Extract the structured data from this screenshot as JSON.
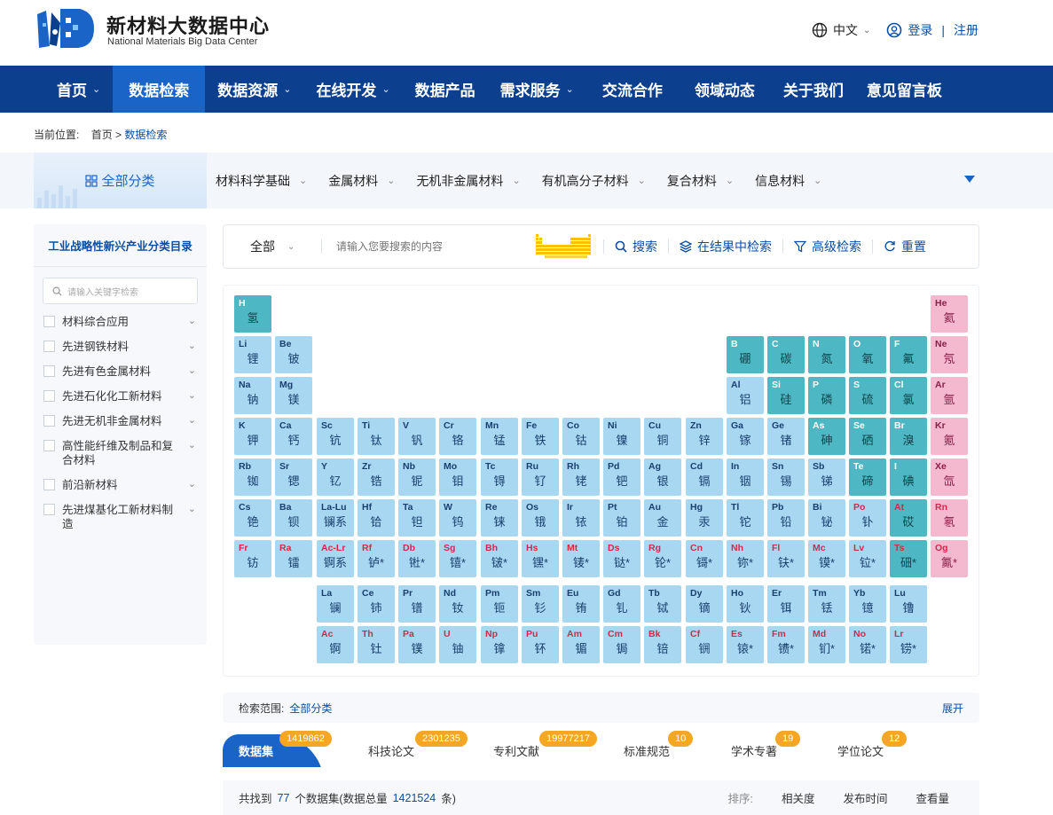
{
  "header": {
    "logo_title": "新材料大数据中心",
    "logo_subtitle": "National Materials Big Data Center",
    "lang": "中文",
    "login": "登录",
    "separator": "|",
    "register": "注册"
  },
  "nav": [
    {
      "label": "首页",
      "has_dropdown": true
    },
    {
      "label": "数据检索",
      "has_dropdown": false,
      "active": true
    },
    {
      "label": "数据资源",
      "has_dropdown": true
    },
    {
      "label": "在线开发",
      "has_dropdown": true
    },
    {
      "label": "数据产品",
      "has_dropdown": false
    },
    {
      "label": "需求服务",
      "has_dropdown": true
    },
    {
      "label": "交流合作",
      "has_dropdown": false
    },
    {
      "label": "领域动态",
      "has_dropdown": false
    },
    {
      "label": "关于我们",
      "has_dropdown": false
    },
    {
      "label": "意见留言板",
      "has_dropdown": false
    }
  ],
  "breadcrumb": {
    "prefix": "当前位置:",
    "home": "首页",
    "sep": ">",
    "current": "数据检索"
  },
  "categories": {
    "all": "全部分类",
    "items": [
      "材料科学基础",
      "金属材料",
      "无机非金属材料",
      "有机高分子材料",
      "复合材料",
      "信息材料"
    ]
  },
  "sidebar": {
    "title": "工业战略性新兴产业分类目录",
    "search_placeholder": "请输入关键字检索",
    "items": [
      "材料综合应用",
      "先进钢铁材料",
      "先进有色金属材料",
      "先进石化化工新材料",
      "先进无机非金属材料",
      "高性能纤维及制品和复合材料",
      "前沿新材料",
      "先进煤基化工新材料制造"
    ]
  },
  "search": {
    "scope": "全部",
    "placeholder": "请输入您要搜索的内容",
    "search_btn": "搜索",
    "in_result_btn": "在结果中检索",
    "advanced_btn": "高级检索",
    "reset_btn": "重置"
  },
  "periodic_table": [
    {
      "sym": "H",
      "cn": "氢",
      "row": 0,
      "col": 0,
      "type": "tl"
    },
    {
      "sym": "He",
      "cn": "氦",
      "row": 0,
      "col": 17,
      "type": "pk"
    },
    {
      "sym": "Li",
      "cn": "锂",
      "row": 1,
      "col": 0,
      "type": "lb"
    },
    {
      "sym": "Be",
      "cn": "铍",
      "row": 1,
      "col": 1,
      "type": "lb"
    },
    {
      "sym": "B",
      "cn": "硼",
      "row": 1,
      "col": 12,
      "type": "tl"
    },
    {
      "sym": "C",
      "cn": "碳",
      "row": 1,
      "col": 13,
      "type": "tl"
    },
    {
      "sym": "N",
      "cn": "氮",
      "row": 1,
      "col": 14,
      "type": "tl"
    },
    {
      "sym": "O",
      "cn": "氧",
      "row": 1,
      "col": 15,
      "type": "tl"
    },
    {
      "sym": "F",
      "cn": "氟",
      "row": 1,
      "col": 16,
      "type": "tl"
    },
    {
      "sym": "Ne",
      "cn": "氖",
      "row": 1,
      "col": 17,
      "type": "pk"
    },
    {
      "sym": "Na",
      "cn": "钠",
      "row": 2,
      "col": 0,
      "type": "lb"
    },
    {
      "sym": "Mg",
      "cn": "镁",
      "row": 2,
      "col": 1,
      "type": "lb"
    },
    {
      "sym": "Al",
      "cn": "铝",
      "row": 2,
      "col": 12,
      "type": "lb"
    },
    {
      "sym": "Si",
      "cn": "硅",
      "row": 2,
      "col": 13,
      "type": "tl"
    },
    {
      "sym": "P",
      "cn": "磷",
      "row": 2,
      "col": 14,
      "type": "tl"
    },
    {
      "sym": "S",
      "cn": "硫",
      "row": 2,
      "col": 15,
      "type": "tl"
    },
    {
      "sym": "Cl",
      "cn": "氯",
      "row": 2,
      "col": 16,
      "type": "tl"
    },
    {
      "sym": "Ar",
      "cn": "氩",
      "row": 2,
      "col": 17,
      "type": "pk"
    },
    {
      "sym": "K",
      "cn": "钾",
      "row": 3,
      "col": 0,
      "type": "lb"
    },
    {
      "sym": "Ca",
      "cn": "钙",
      "row": 3,
      "col": 1,
      "type": "lb"
    },
    {
      "sym": "Sc",
      "cn": "钪",
      "row": 3,
      "col": 2,
      "type": "lb"
    },
    {
      "sym": "Ti",
      "cn": "钛",
      "row": 3,
      "col": 3,
      "type": "lb"
    },
    {
      "sym": "V",
      "cn": "钒",
      "row": 3,
      "col": 4,
      "type": "lb"
    },
    {
      "sym": "Cr",
      "cn": "铬",
      "row": 3,
      "col": 5,
      "type": "lb"
    },
    {
      "sym": "Mn",
      "cn": "锰",
      "row": 3,
      "col": 6,
      "type": "lb"
    },
    {
      "sym": "Fe",
      "cn": "铁",
      "row": 3,
      "col": 7,
      "type": "lb"
    },
    {
      "sym": "Co",
      "cn": "钴",
      "row": 3,
      "col": 8,
      "type": "lb"
    },
    {
      "sym": "Ni",
      "cn": "镍",
      "row": 3,
      "col": 9,
      "type": "lb"
    },
    {
      "sym": "Cu",
      "cn": "铜",
      "row": 3,
      "col": 10,
      "type": "lb"
    },
    {
      "sym": "Zn",
      "cn": "锌",
      "row": 3,
      "col": 11,
      "type": "lb"
    },
    {
      "sym": "Ga",
      "cn": "镓",
      "row": 3,
      "col": 12,
      "type": "lb"
    },
    {
      "sym": "Ge",
      "cn": "锗",
      "row": 3,
      "col": 13,
      "type": "lb"
    },
    {
      "sym": "As",
      "cn": "砷",
      "row": 3,
      "col": 14,
      "type": "tl"
    },
    {
      "sym": "Se",
      "cn": "硒",
      "row": 3,
      "col": 15,
      "type": "tl"
    },
    {
      "sym": "Br",
      "cn": "溴",
      "row": 3,
      "col": 16,
      "type": "tl"
    },
    {
      "sym": "Kr",
      "cn": "氪",
      "row": 3,
      "col": 17,
      "type": "pk"
    },
    {
      "sym": "Rb",
      "cn": "铷",
      "row": 4,
      "col": 0,
      "type": "lb"
    },
    {
      "sym": "Sr",
      "cn": "锶",
      "row": 4,
      "col": 1,
      "type": "lb"
    },
    {
      "sym": "Y",
      "cn": "钇",
      "row": 4,
      "col": 2,
      "type": "lb"
    },
    {
      "sym": "Zr",
      "cn": "锆",
      "row": 4,
      "col": 3,
      "type": "lb"
    },
    {
      "sym": "Nb",
      "cn": "铌",
      "row": 4,
      "col": 4,
      "type": "lb"
    },
    {
      "sym": "Mo",
      "cn": "钼",
      "row": 4,
      "col": 5,
      "type": "lb"
    },
    {
      "sym": "Tc",
      "cn": "锝",
      "row": 4,
      "col": 6,
      "type": "lb"
    },
    {
      "sym": "Ru",
      "cn": "钌",
      "row": 4,
      "col": 7,
      "type": "lb"
    },
    {
      "sym": "Rh",
      "cn": "铑",
      "row": 4,
      "col": 8,
      "type": "lb"
    },
    {
      "sym": "Pd",
      "cn": "钯",
      "row": 4,
      "col": 9,
      "type": "lb"
    },
    {
      "sym": "Ag",
      "cn": "银",
      "row": 4,
      "col": 10,
      "type": "lb"
    },
    {
      "sym": "Cd",
      "cn": "镉",
      "row": 4,
      "col": 11,
      "type": "lb"
    },
    {
      "sym": "In",
      "cn": "铟",
      "row": 4,
      "col": 12,
      "type": "lb"
    },
    {
      "sym": "Sn",
      "cn": "锡",
      "row": 4,
      "col": 13,
      "type": "lb"
    },
    {
      "sym": "Sb",
      "cn": "锑",
      "row": 4,
      "col": 14,
      "type": "lb"
    },
    {
      "sym": "Te",
      "cn": "碲",
      "row": 4,
      "col": 15,
      "type": "tl"
    },
    {
      "sym": "I",
      "cn": "碘",
      "row": 4,
      "col": 16,
      "type": "tl"
    },
    {
      "sym": "Xe",
      "cn": "氙",
      "row": 4,
      "col": 17,
      "type": "pk"
    },
    {
      "sym": "Cs",
      "cn": "铯",
      "row": 5,
      "col": 0,
      "type": "lb"
    },
    {
      "sym": "Ba",
      "cn": "钡",
      "row": 5,
      "col": 1,
      "type": "lb"
    },
    {
      "sym": "La-Lu",
      "cn": "镧系",
      "row": 5,
      "col": 2,
      "type": "lb"
    },
    {
      "sym": "Hf",
      "cn": "铪",
      "row": 5,
      "col": 3,
      "type": "lb"
    },
    {
      "sym": "Ta",
      "cn": "钽",
      "row": 5,
      "col": 4,
      "type": "lb"
    },
    {
      "sym": "W",
      "cn": "钨",
      "row": 5,
      "col": 5,
      "type": "lb"
    },
    {
      "sym": "Re",
      "cn": "铼",
      "row": 5,
      "col": 6,
      "type": "lb"
    },
    {
      "sym": "Os",
      "cn": "锇",
      "row": 5,
      "col": 7,
      "type": "lb"
    },
    {
      "sym": "Ir",
      "cn": "铱",
      "row": 5,
      "col": 8,
      "type": "lb"
    },
    {
      "sym": "Pt",
      "cn": "铂",
      "row": 5,
      "col": 9,
      "type": "lb"
    },
    {
      "sym": "Au",
      "cn": "金",
      "row": 5,
      "col": 10,
      "type": "lb"
    },
    {
      "sym": "Hg",
      "cn": "汞",
      "row": 5,
      "col": 11,
      "type": "lb"
    },
    {
      "sym": "Tl",
      "cn": "铊",
      "row": 5,
      "col": 12,
      "type": "lb"
    },
    {
      "sym": "Pb",
      "cn": "铅",
      "row": 5,
      "col": 13,
      "type": "lb"
    },
    {
      "sym": "Bi",
      "cn": "铋",
      "row": 5,
      "col": 14,
      "type": "lb"
    },
    {
      "sym": "Po",
      "cn": "钋",
      "row": 5,
      "col": 15,
      "type": "lb",
      "red": true
    },
    {
      "sym": "At",
      "cn": "砹",
      "row": 5,
      "col": 16,
      "type": "tl",
      "red": true
    },
    {
      "sym": "Rn",
      "cn": "氡",
      "row": 5,
      "col": 17,
      "type": "pk",
      "red": true
    },
    {
      "sym": "Fr",
      "cn": "钫",
      "row": 6,
      "col": 0,
      "type": "lb",
      "red": true
    },
    {
      "sym": "Ra",
      "cn": "镭",
      "row": 6,
      "col": 1,
      "type": "lb",
      "red": true
    },
    {
      "sym": "Ac-Lr",
      "cn": "锕系",
      "row": 6,
      "col": 2,
      "type": "lb",
      "red": true
    },
    {
      "sym": "Rf",
      "cn": "𬬻*",
      "row": 6,
      "col": 3,
      "type": "lb",
      "red": true
    },
    {
      "sym": "Db",
      "cn": "𬭊*",
      "row": 6,
      "col": 4,
      "type": "lb",
      "red": true
    },
    {
      "sym": "Sg",
      "cn": "𬭳*",
      "row": 6,
      "col": 5,
      "type": "lb",
      "red": true
    },
    {
      "sym": "Bh",
      "cn": "𬭛*",
      "row": 6,
      "col": 6,
      "type": "lb",
      "red": true
    },
    {
      "sym": "Hs",
      "cn": "𬭶*",
      "row": 6,
      "col": 7,
      "type": "lb",
      "red": true
    },
    {
      "sym": "Mt",
      "cn": "鿏*",
      "row": 6,
      "col": 8,
      "type": "lb",
      "red": true
    },
    {
      "sym": "Ds",
      "cn": "𫟼*",
      "row": 6,
      "col": 9,
      "type": "lb",
      "red": true
    },
    {
      "sym": "Rg",
      "cn": "𬬭*",
      "row": 6,
      "col": 10,
      "type": "lb",
      "red": true
    },
    {
      "sym": "Cn",
      "cn": "鿔*",
      "row": 6,
      "col": 11,
      "type": "lb",
      "red": true
    },
    {
      "sym": "Nh",
      "cn": "鿭*",
      "row": 6,
      "col": 12,
      "type": "lb",
      "red": true
    },
    {
      "sym": "Fl",
      "cn": "𫓧*",
      "row": 6,
      "col": 13,
      "type": "lb",
      "red": true
    },
    {
      "sym": "Mc",
      "cn": "镆*",
      "row": 6,
      "col": 14,
      "type": "lb",
      "red": true
    },
    {
      "sym": "Lv",
      "cn": "𫟷*",
      "row": 6,
      "col": 15,
      "type": "lb",
      "red": true
    },
    {
      "sym": "Ts",
      "cn": "鿬*",
      "row": 6,
      "col": 16,
      "type": "tl",
      "red": true
    },
    {
      "sym": "Og",
      "cn": "鿫*",
      "row": 6,
      "col": 17,
      "type": "pk",
      "red": true
    },
    {
      "sym": "La",
      "cn": "镧",
      "row": 7,
      "col": 2,
      "type": "lb"
    },
    {
      "sym": "Ce",
      "cn": "铈",
      "row": 7,
      "col": 3,
      "type": "lb"
    },
    {
      "sym": "Pr",
      "cn": "镨",
      "row": 7,
      "col": 4,
      "type": "lb"
    },
    {
      "sym": "Nd",
      "cn": "钕",
      "row": 7,
      "col": 5,
      "type": "lb"
    },
    {
      "sym": "Pm",
      "cn": "钷",
      "row": 7,
      "col": 6,
      "type": "lb"
    },
    {
      "sym": "Sm",
      "cn": "钐",
      "row": 7,
      "col": 7,
      "type": "lb"
    },
    {
      "sym": "Eu",
      "cn": "铕",
      "row": 7,
      "col": 8,
      "type": "lb"
    },
    {
      "sym": "Gd",
      "cn": "钆",
      "row": 7,
      "col": 9,
      "type": "lb"
    },
    {
      "sym": "Tb",
      "cn": "铽",
      "row": 7,
      "col": 10,
      "type": "lb"
    },
    {
      "sym": "Dy",
      "cn": "镝",
      "row": 7,
      "col": 11,
      "type": "lb"
    },
    {
      "sym": "Ho",
      "cn": "钬",
      "row": 7,
      "col": 12,
      "type": "lb"
    },
    {
      "sym": "Er",
      "cn": "铒",
      "row": 7,
      "col": 13,
      "type": "lb"
    },
    {
      "sym": "Tm",
      "cn": "铥",
      "row": 7,
      "col": 14,
      "type": "lb"
    },
    {
      "sym": "Yb",
      "cn": "镱",
      "row": 7,
      "col": 15,
      "type": "lb"
    },
    {
      "sym": "Lu",
      "cn": "镥",
      "row": 7,
      "col": 16,
      "type": "lb"
    },
    {
      "sym": "Ac",
      "cn": "锕",
      "row": 8,
      "col": 2,
      "type": "lb",
      "red": true
    },
    {
      "sym": "Th",
      "cn": "钍",
      "row": 8,
      "col": 3,
      "type": "lb",
      "red": true
    },
    {
      "sym": "Pa",
      "cn": "镤",
      "row": 8,
      "col": 4,
      "type": "lb",
      "red": true
    },
    {
      "sym": "U",
      "cn": "铀",
      "row": 8,
      "col": 5,
      "type": "lb",
      "red": true
    },
    {
      "sym": "Np",
      "cn": "镎",
      "row": 8,
      "col": 6,
      "type": "lb",
      "red": true
    },
    {
      "sym": "Pu",
      "cn": "钚",
      "row": 8,
      "col": 7,
      "type": "lb",
      "red": true
    },
    {
      "sym": "Am",
      "cn": "镅",
      "row": 8,
      "col": 8,
      "type": "lb",
      "red": true
    },
    {
      "sym": "Cm",
      "cn": "锔",
      "row": 8,
      "col": 9,
      "type": "lb",
      "red": true
    },
    {
      "sym": "Bk",
      "cn": "锫",
      "row": 8,
      "col": 10,
      "type": "lb",
      "red": true
    },
    {
      "sym": "Cf",
      "cn": "锎",
      "row": 8,
      "col": 11,
      "type": "lb",
      "red": true
    },
    {
      "sym": "Es",
      "cn": "锿*",
      "row": 8,
      "col": 12,
      "type": "lb",
      "red": true
    },
    {
      "sym": "Fm",
      "cn": "镄*",
      "row": 8,
      "col": 13,
      "type": "lb",
      "red": true
    },
    {
      "sym": "Md",
      "cn": "钔*",
      "row": 8,
      "col": 14,
      "type": "lb",
      "red": true
    },
    {
      "sym": "No",
      "cn": "锘*",
      "row": 8,
      "col": 15,
      "type": "lb",
      "red": true
    },
    {
      "sym": "Lr",
      "cn": "铹*",
      "row": 8,
      "col": 16,
      "type": "lb",
      "red": true
    }
  ],
  "range": {
    "label": "检索范围:",
    "value": "全部分类",
    "expand": "展开"
  },
  "tabs": [
    {
      "label": "数据集",
      "count": "1419862"
    },
    {
      "label": "科技论文",
      "count": "2301235"
    },
    {
      "label": "专利文献",
      "count": "19977217"
    },
    {
      "label": "标准规范",
      "count": "10"
    },
    {
      "label": "学术专著",
      "count": "19"
    },
    {
      "label": "学位论文",
      "count": "12"
    }
  ],
  "results": {
    "prefix": "共找到",
    "count": "77",
    "mid": "个数据集(数据总量",
    "total": "1421524",
    "suffix": "条)",
    "sort_label": "排序:",
    "sort_options": [
      "相关度",
      "发布时间",
      "查看量"
    ]
  },
  "colors": {
    "nav_bg": "#0c3f8e",
    "nav_active": "#1a64c8",
    "accent": "#0b4ea2",
    "badge": "#f5a623",
    "el_lightblue": "#a8d7f2",
    "el_teal": "#4db8c4",
    "el_pink": "#f4b8cf"
  }
}
